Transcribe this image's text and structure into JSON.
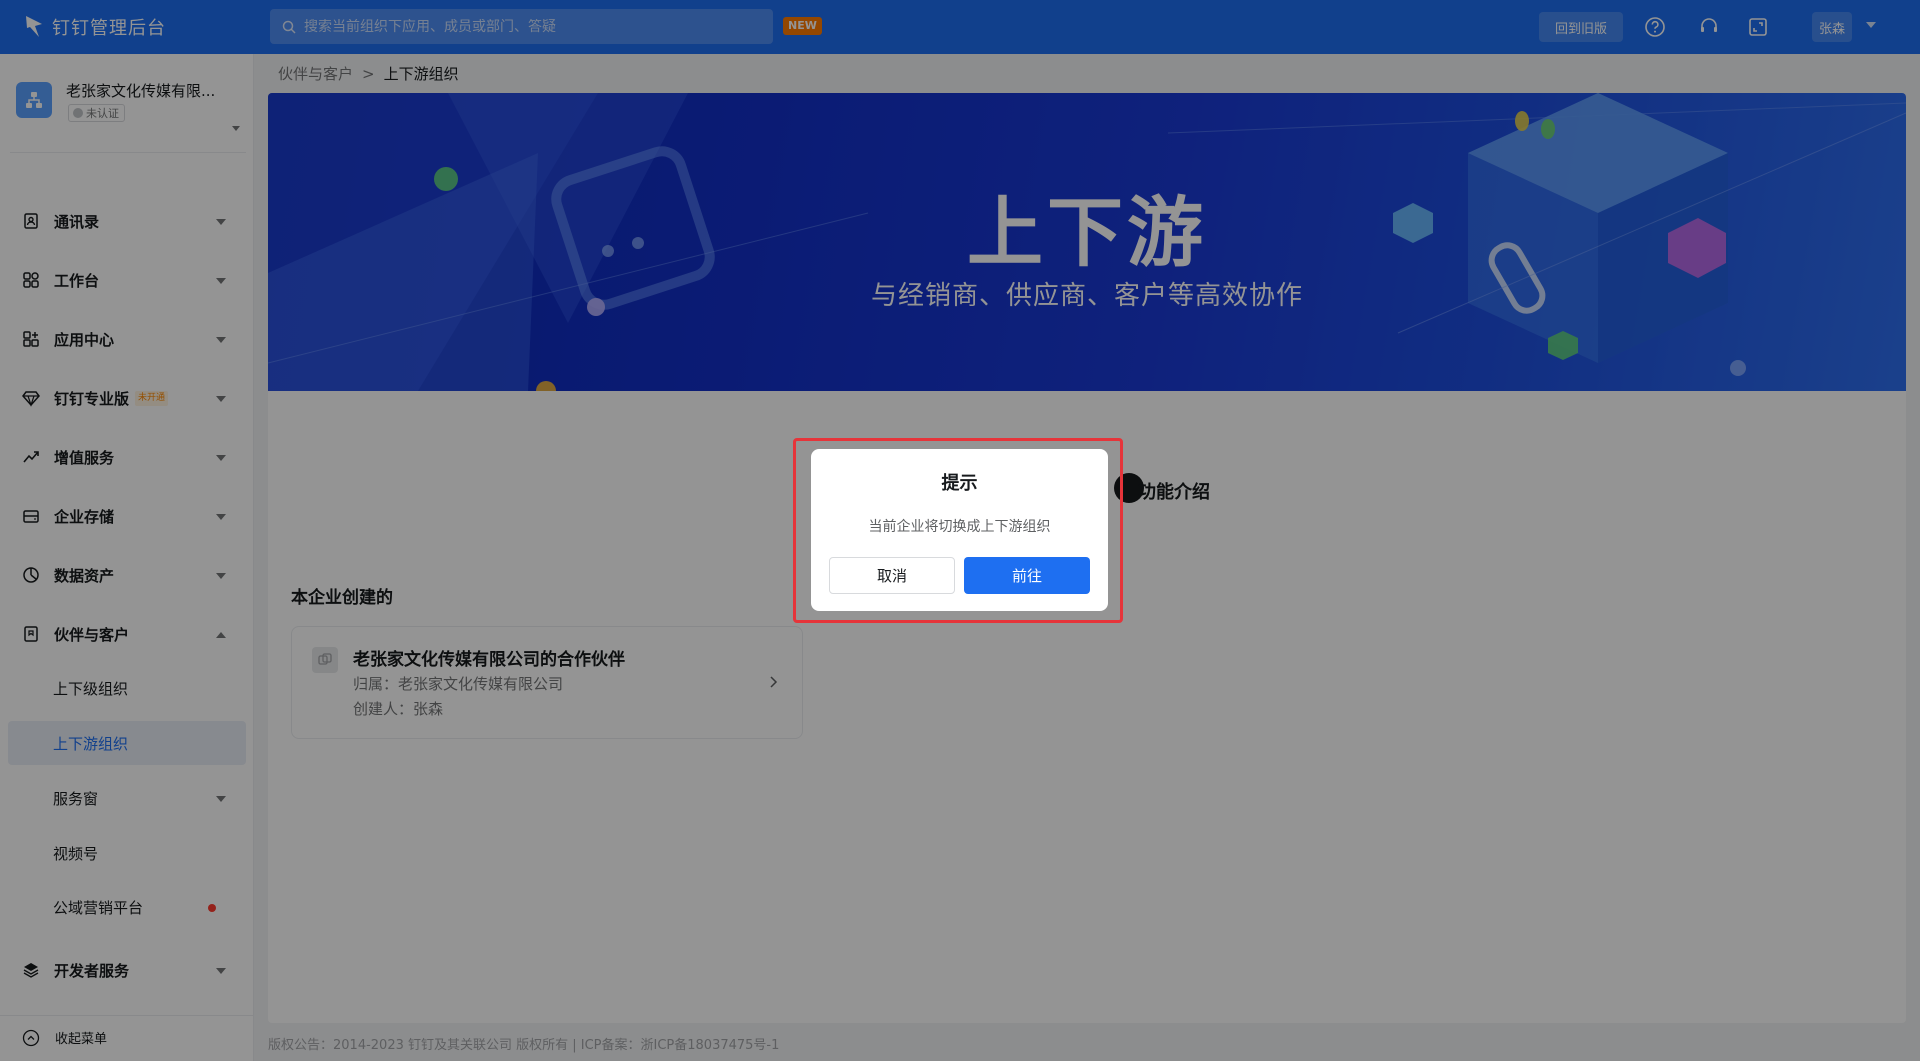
{
  "topbar": {
    "brand": "钉钉管理后台",
    "search_placeholder": "搜索当前组织下应用、成员或部门、答疑",
    "new_badge": "NEW",
    "old_version": "回到旧版",
    "user": "张森"
  },
  "org": {
    "name": "老张家文化传媒有限...",
    "badge": "未认证"
  },
  "sidebar": {
    "items": [
      {
        "label": "通讯录",
        "icon": "contacts-icon"
      },
      {
        "label": "工作台",
        "icon": "workbench-icon"
      },
      {
        "label": "应用中心",
        "icon": "app-center-icon"
      },
      {
        "label": "钉钉专业版",
        "icon": "diamond-icon",
        "tag": "未开通"
      },
      {
        "label": "增值服务",
        "icon": "trend-icon"
      },
      {
        "label": "企业存储",
        "icon": "storage-icon"
      },
      {
        "label": "数据资产",
        "icon": "data-asset-icon"
      },
      {
        "label": "伙伴与客户",
        "icon": "partner-icon"
      },
      {
        "label": "开发者服务",
        "icon": "developer-icon"
      }
    ],
    "subitems": [
      {
        "label": "上下级组织"
      },
      {
        "label": "上下游组织"
      },
      {
        "label": "服务窗"
      },
      {
        "label": "视频号"
      },
      {
        "label": "公域营销平台"
      }
    ],
    "collapse_label": "收起菜单"
  },
  "breadcrumb": {
    "parent": "伙伴与客户",
    "separator": ">",
    "current": "上下游组织"
  },
  "banner": {
    "title": "上下游",
    "subtitle": "与经销商、供应商、客户等高效协作"
  },
  "main": {
    "feature_intro": "功能介绍",
    "section_title": "本企业创建的",
    "partner_card": {
      "title": "老张家文化传媒有限公司的合作伙伴",
      "owner": "归属：老张家文化传媒有限公司",
      "creator": "创建人：张森"
    }
  },
  "footer": "版权公告：2014-2023 钉钉及其关联公司 版权所有 | ICP备案：浙ICP备18037475号-1",
  "dialog": {
    "title": "提示",
    "message": "当前企业将切换成上下游组织",
    "cancel": "取消",
    "confirm": "前往"
  },
  "colors": {
    "primary": "#1e6ff1",
    "highlight": "#e6343a",
    "badge_new": "#ff7a00"
  }
}
